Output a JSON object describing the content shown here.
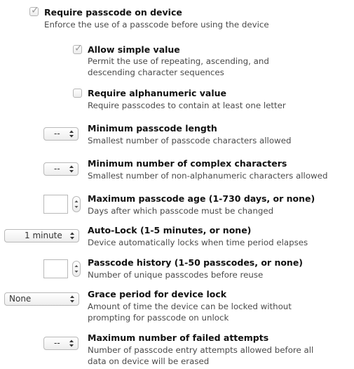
{
  "settings": [
    {
      "title": "Require passcode on device",
      "description": [
        "Enforce the use of a passcode before using the device"
      ],
      "checked": true
    },
    {
      "title": "Allow simple value",
      "description": [
        "Permit the use of repeating, ascending, and",
        "descending character sequences"
      ],
      "checked": true
    },
    {
      "title": "Require alphanumeric value",
      "description": [
        "Require passcodes to contain at least one letter"
      ],
      "checked": false
    },
    {
      "title": "Minimum passcode length",
      "description": [
        "Smallest number of passcode characters allowed"
      ],
      "control_value": "--"
    },
    {
      "title": "Minimum number of complex characters",
      "description": [
        "Smallest number of non-alphanumeric characters allowed"
      ],
      "control_value": "--"
    },
    {
      "title": "Maximum passcode age (1-730 days, or none)",
      "description": [
        "Days after which passcode must be changed"
      ],
      "control_value": ""
    },
    {
      "title": "Auto-Lock (1-5 minutes, or none)",
      "description": [
        "Device automatically locks when time period elapses"
      ],
      "control_value": "1 minute"
    },
    {
      "title": "Passcode history (1-50 passcodes, or none)",
      "description": [
        "Number of unique passcodes before reuse"
      ],
      "control_value": ""
    },
    {
      "title": "Grace period for device lock",
      "description": [
        "Amount of time the device can be locked without",
        "prompting for passcode on unlock"
      ],
      "control_value": "None"
    },
    {
      "title": "Maximum number of failed attempts",
      "description": [
        "Number of passcode entry attempts allowed before all",
        "data on device will be erased"
      ],
      "control_value": "--"
    }
  ],
  "icons": {
    "checkmark": "checkmark-icon",
    "popup_arrows": "up-down-arrows-icon",
    "stepper_arrows": "stepper-arrows-icon"
  },
  "colors": {
    "title": "#111111",
    "description": "#4a4a4a",
    "control_border": "#b9b9b9",
    "checkmark": "#9a9a9a"
  }
}
